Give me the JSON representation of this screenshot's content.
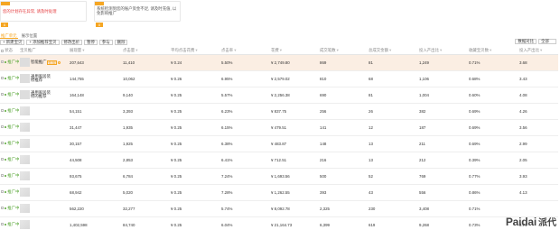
{
  "notices": [
    {
      "text": "您的计划存在异常, 请及时处理",
      "dismiss": "x"
    },
    {
      "text": "系统检测到您的账户资金不足, 请及时充值, 以免影响推广",
      "dismiss": "x"
    }
  ],
  "tabs": [
    {
      "label": "推广单元"
    },
    {
      "label": "展示位置"
    }
  ],
  "toolbar": {
    "buttons": [
      "+ 新建宝贝",
      "+ 添加推荐宝贝",
      "修改出价",
      "暂停",
      "参与",
      "删除"
    ],
    "right": {
      "filter": "数据对比",
      "select": "全部"
    }
  },
  "table": {
    "headers": [
      "状态",
      "宝贝推广",
      "展现量",
      "点击量",
      "平均点击花费",
      "点击率",
      "花费",
      "成交笔数",
      "总成交金额",
      "投入产出比",
      "收藏宝贝数",
      "投入产出比"
    ],
    "rows": [
      {
        "status": "推广中",
        "name": "智能推广",
        "badge": "智能",
        "impr": "207,643",
        "clicks": "11,410",
        "cpc": "¥ 0.24",
        "ctr": "5.50%",
        "cost": "¥ 2,749.80",
        "orders": "869",
        "amount": "81",
        "roi": "1,249",
        "fav": "0.71%",
        "roi2": "3.68",
        "highlight": true
      },
      {
        "status": "推广中",
        "name": "通用家居装修推荐",
        "badge": "",
        "impr": "144,755",
        "clicks": "10,062",
        "cpc": "¥ 0.26",
        "ctr": "6.95%",
        "cost": "¥ 2,579.02",
        "orders": "810",
        "amount": "68",
        "roi": "1,106",
        "fav": "0.68%",
        "roi2": "3.43",
        "highlight": false
      },
      {
        "status": "推广中",
        "name": "通用家居装修的推荐",
        "badge": "",
        "impr": "164,148",
        "clicks": "9,140",
        "cpc": "¥ 0.25",
        "ctr": "5.57%",
        "cost": "¥ 2,256.38",
        "orders": "690",
        "amount": "81",
        "roi": "1,004",
        "fav": "0.60%",
        "roi2": "4.08",
        "highlight": false
      },
      {
        "status": "推广中",
        "name": "",
        "badge": "",
        "impr": "54,151",
        "clicks": "3,393",
        "cpc": "¥ 0.25",
        "ctr": "6.23%",
        "cost": "¥ 837.75",
        "orders": "256",
        "amount": "26",
        "roi": "382",
        "fav": "0.69%",
        "roi2": "4.26",
        "highlight": false
      },
      {
        "status": "推广中",
        "name": "",
        "badge": "",
        "impr": "31,447",
        "clicks": "1,935",
        "cpc": "¥ 0.25",
        "ctr": "6.15%",
        "cost": "¥ 479.51",
        "orders": "141",
        "amount": "12",
        "roi": "187",
        "fav": "0.69%",
        "roi2": "3.56",
        "highlight": false
      },
      {
        "status": "推广中",
        "name": "",
        "badge": "",
        "impr": "30,157",
        "clicks": "1,925",
        "cpc": "¥ 0.25",
        "ctr": "6.38%",
        "cost": "¥ 483.87",
        "orders": "148",
        "amount": "13",
        "roi": "211",
        "fav": "0.69%",
        "roi2": "2.99",
        "highlight": false
      },
      {
        "status": "推广中",
        "name": "",
        "badge": "",
        "impr": "44,508",
        "clicks": "2,853",
        "cpc": "¥ 0.25",
        "ctr": "6.41%",
        "cost": "¥ 712.51",
        "orders": "216",
        "amount": "13",
        "roi": "212",
        "fav": "0.39%",
        "roi2": "2.05",
        "highlight": false
      },
      {
        "status": "推广中",
        "name": "",
        "badge": "",
        "impr": "93,675",
        "clicks": "6,784",
        "cpc": "¥ 0.25",
        "ctr": "7.24%",
        "cost": "¥ 1,693.56",
        "orders": "500",
        "amount": "52",
        "roi": "769",
        "fav": "0.77%",
        "roi2": "3.93",
        "highlight": false
      },
      {
        "status": "推广中",
        "name": "",
        "badge": "",
        "impr": "68,942",
        "clicks": "5,020",
        "cpc": "¥ 0.25",
        "ctr": "7.28%",
        "cost": "¥ 1,262.55",
        "orders": "393",
        "amount": "43",
        "roi": "556",
        "fav": "0.86%",
        "roi2": "4.13",
        "highlight": false
      },
      {
        "status": "推广中",
        "name": "",
        "badge": "",
        "impr": "562,220",
        "clicks": "32,277",
        "cpc": "¥ 0.25",
        "ctr": "5.74%",
        "cost": "¥ 8,092.78",
        "orders": "2,325",
        "amount": "230",
        "roi": "3,408",
        "fav": "0.71%",
        "roi2": "",
        "highlight": false
      },
      {
        "status": "推广中",
        "name": "",
        "badge": "",
        "impr": "1,402,598",
        "clicks": "84,740",
        "cpc": "¥ 0.25",
        "ctr": "6.04%",
        "cost": "¥ 21,164.73",
        "orders": "6,399",
        "amount": "619",
        "roi": "9,268",
        "fav": "0.73%",
        "roi2": "3.74",
        "highlight": false
      }
    ]
  },
  "watermark": {
    "latin": "Paidai",
    "cn": "派代"
  },
  "colors": {
    "accent": "#f5a623",
    "status_green": "#55a532",
    "highlight_row": "#fbeee3"
  }
}
